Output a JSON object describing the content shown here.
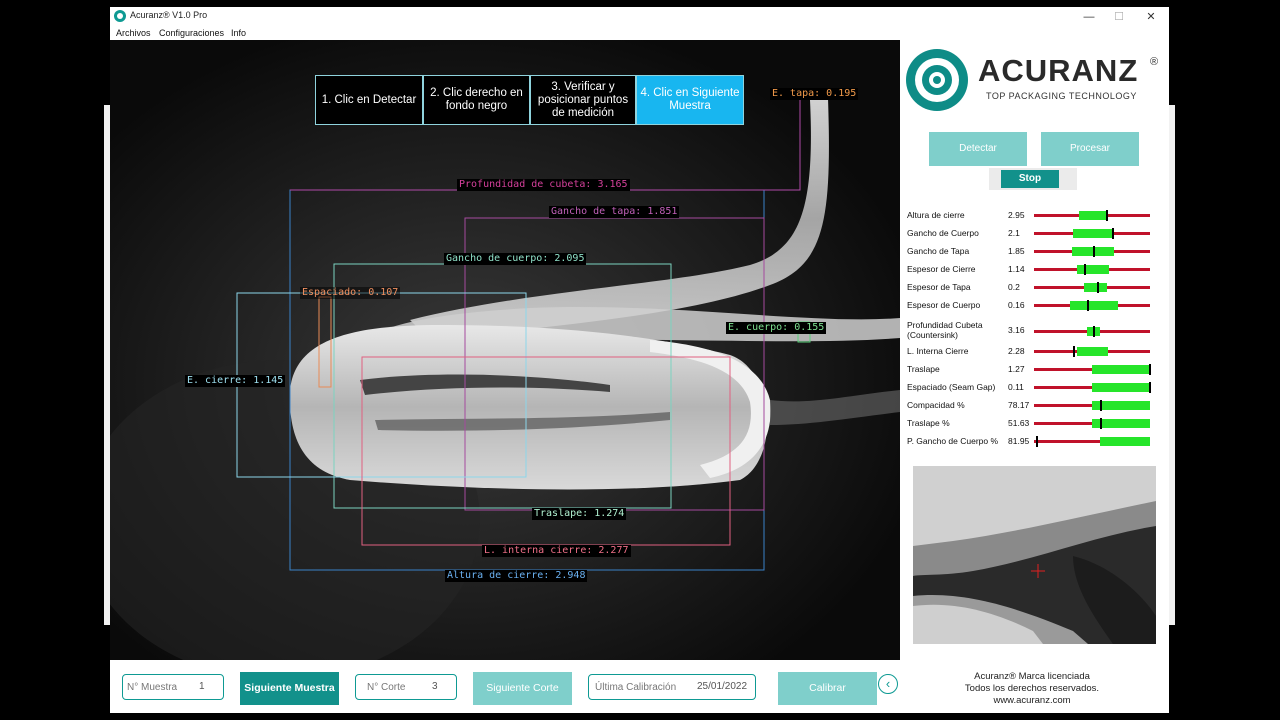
{
  "window": {
    "title": "Acuranz® V1.0 Pro",
    "controls": {
      "minimize": "—",
      "maximize": "☐",
      "close": "✕"
    }
  },
  "menu": [
    "Archivos",
    "Configuraciones",
    "Info"
  ],
  "steps": [
    {
      "label": "1. Clic en Detectar",
      "active": false
    },
    {
      "label": "2. Clic derecho en fondo negro",
      "active": false
    },
    {
      "label": "3. Verificar y posicionar puntos de medición",
      "active": false
    },
    {
      "label": "4. Clic en Siguiente Muestra",
      "active": true
    }
  ],
  "overlay_labels": {
    "e_tapa": "E. tapa: 0.195",
    "profundidad": "Profundidad de cubeta: 3.165",
    "gancho_tapa": "Gancho de tapa: 1.851",
    "gancho_cuerpo": "Gancho de cuerpo: 2.095",
    "espaciado": "Espaciado: 0.107",
    "e_cuerpo": "E. cuerpo: 0.155",
    "e_cierre": "E. cierre: 1.145",
    "traslape": "Traslape: 1.274",
    "l_interna": "L. interna cierre: 2.277",
    "altura": "Altura de cierre: 2.948"
  },
  "brand": {
    "name": "ACURANZ",
    "reg": "®",
    "tagline": "TOP PACKAGING TECHNOLOGY",
    "color": "#0e8c87"
  },
  "buttons": {
    "detectar": "Detectar",
    "procesar": "Procesar",
    "stop": "Stop",
    "siguiente_muestra": "Siguiente Muestra",
    "siguiente_corte": "Siguiente Corte",
    "calibrar": "Calibrar",
    "back": "‹"
  },
  "measurements": [
    {
      "name": "Altura de cierre",
      "value": "2.95",
      "green": [
        0.39,
        0.63
      ],
      "tick": 0.62
    },
    {
      "name": "Gancho de Cuerpo",
      "value": "2.1",
      "green": [
        0.34,
        0.67
      ],
      "tick": 0.67
    },
    {
      "name": "Gancho de Tapa",
      "value": "1.85",
      "green": [
        0.33,
        0.69
      ],
      "tick": 0.51
    },
    {
      "name": "Espesor de Cierre",
      "value": "1.14",
      "green": [
        0.37,
        0.65
      ],
      "tick": 0.43
    },
    {
      "name": "Espesor de Tapa",
      "value": "0.2",
      "green": [
        0.43,
        0.63
      ],
      "tick": 0.54
    },
    {
      "name": "Espesor de Cuerpo",
      "value": "0.16",
      "green": [
        0.31,
        0.72
      ],
      "tick": 0.46
    },
    {
      "name": "Profundidad Cubeta (Countersink)",
      "value": "3.16",
      "green": [
        0.46,
        0.57
      ],
      "tick": 0.51
    },
    {
      "name": "L. Interna Cierre",
      "value": "2.28",
      "green": [
        0.37,
        0.64
      ],
      "tick": 0.34
    },
    {
      "name": "Traslape",
      "value": "1.27",
      "green": [
        0.5,
        1.0
      ],
      "tick": 0.99
    },
    {
      "name": "Espaciado (Seam Gap)",
      "value": "0.11",
      "green": [
        0.5,
        1.0
      ],
      "tick": 0.99
    },
    {
      "name": "Compacidad %",
      "value": "78.17",
      "green": [
        0.5,
        1.0
      ],
      "tick": 0.57
    },
    {
      "name": "Traslape %",
      "value": "51.63",
      "green": [
        0.5,
        1.0
      ],
      "tick": 0.57
    },
    {
      "name": "P. Gancho de Cuerpo %",
      "value": "81.95",
      "green": [
        0.57,
        1.0
      ],
      "tick": 0.02
    }
  ],
  "fields": {
    "muestra_label": "N° Muestra",
    "muestra_value": "1",
    "corte_label": "N° Corte",
    "corte_value": "3",
    "calibracion_label": "Última Calibración",
    "calibracion_value": "25/01/2022"
  },
  "legal": {
    "line1": "Acuranz® Marca licenciada",
    "line2": "Todos los derechos reservados.",
    "line3": "www.acuranz.com"
  }
}
